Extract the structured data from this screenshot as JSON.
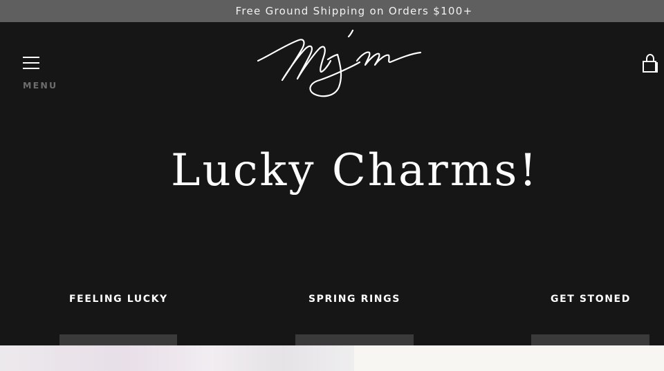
{
  "announcement": {
    "text": "Free Ground Shipping on Orders $100+"
  },
  "header": {
    "menu_label": "MENU",
    "menu_icon": "hamburger-menu-icon",
    "logo_icon": "mjm-signature-logo",
    "cart_icon": "shopping-bag-icon"
  },
  "hero": {
    "title": "Lucky Charms!"
  },
  "collections": [
    {
      "label": "FEELING LUCKY"
    },
    {
      "label": "SPRING RINGS"
    },
    {
      "label": "GET STONED"
    }
  ],
  "colors": {
    "announcement_bg": "#5f5f5f",
    "page_bg": "#161616",
    "text": "#ffffff",
    "menu_label": "#6d6d6d"
  }
}
